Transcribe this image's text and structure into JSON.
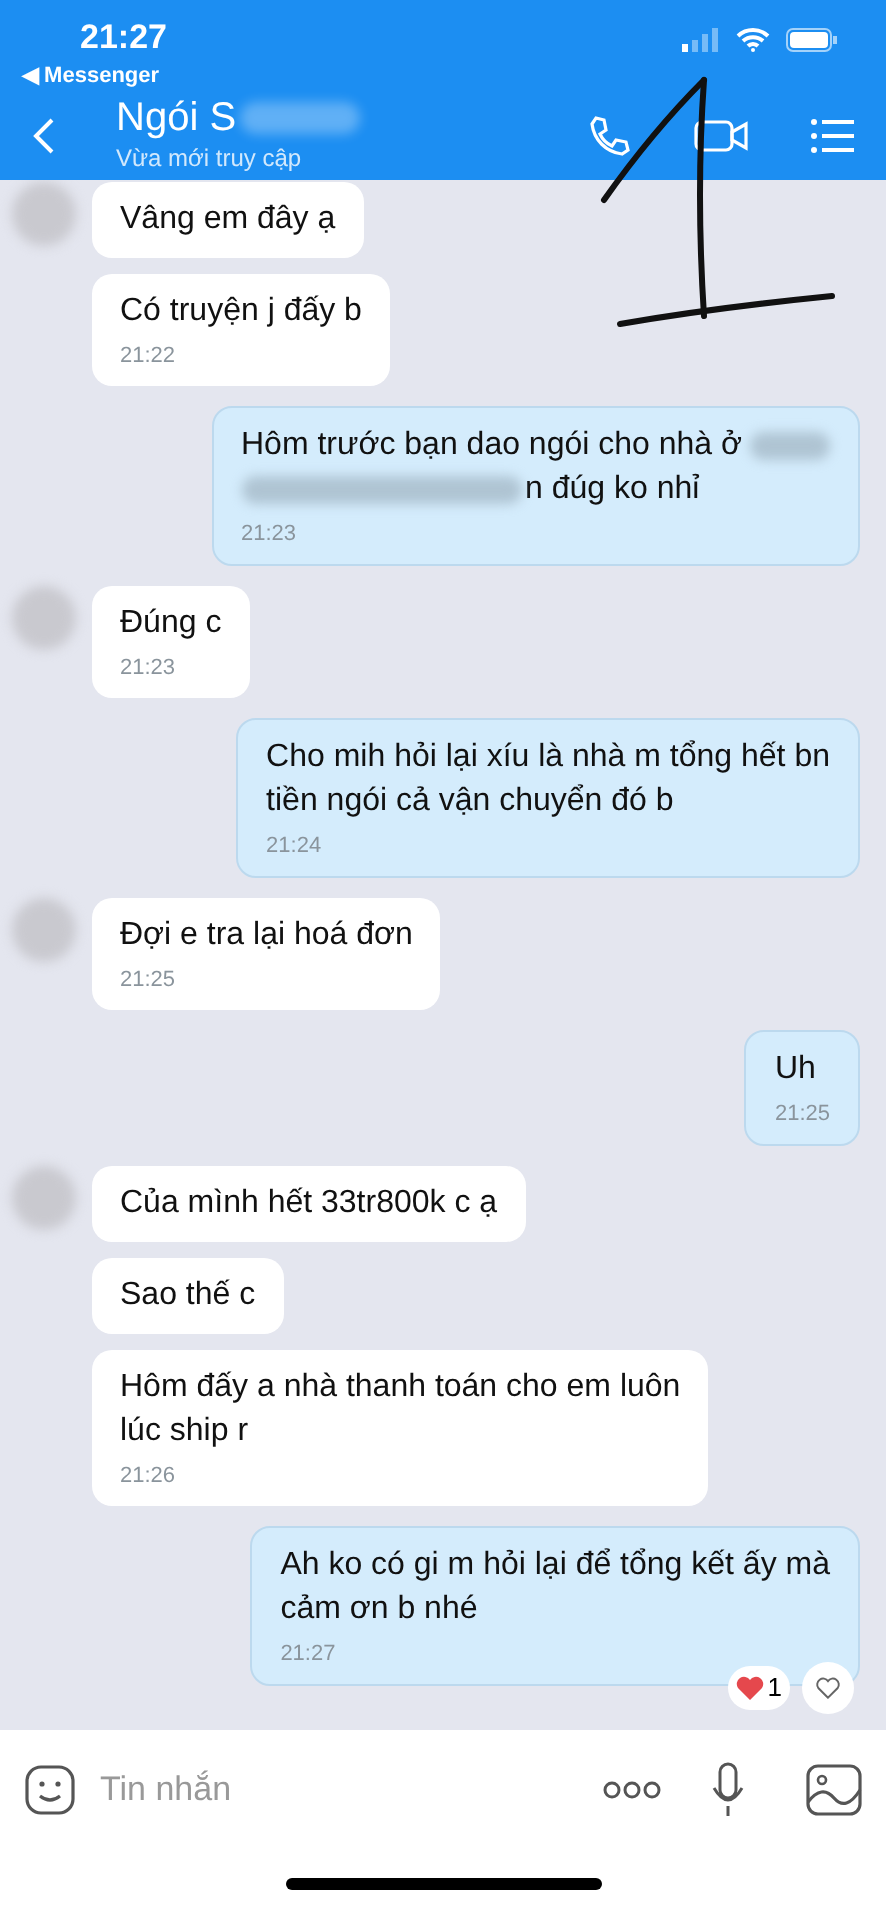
{
  "status_bar": {
    "time": "21:27",
    "back_app": "◀ Messenger"
  },
  "header": {
    "title": "Ngói S",
    "subtitle": "Vừa mới truy cập"
  },
  "messages": [
    {
      "kind": "incoming",
      "avatar": true,
      "lines": [
        "Vâng em đây ạ"
      ]
    },
    {
      "kind": "incoming",
      "avatar": false,
      "lines": [
        "Có truyện j đấy b"
      ],
      "time": "21:22"
    },
    {
      "kind": "outgoing",
      "lines": [
        "Hôm trước bạn dao ngói cho nhà ở",
        "n đúg ko nhỉ"
      ],
      "blurred": true,
      "time": "21:23"
    },
    {
      "kind": "incoming",
      "avatar": true,
      "lines": [
        "Đúng c"
      ],
      "time": "21:23"
    },
    {
      "kind": "outgoing",
      "lines": [
        "Cho mih hỏi lại xíu là nhà m tổng hết bn",
        "tiền ngói cả vận chuyển đó b"
      ],
      "time": "21:24"
    },
    {
      "kind": "incoming",
      "avatar": true,
      "lines": [
        "Đợi e tra lại hoá đơn"
      ],
      "time": "21:25"
    },
    {
      "kind": "outgoing",
      "lines": [
        "Uh"
      ],
      "time": "21:25"
    },
    {
      "kind": "incoming",
      "avatar": true,
      "lines": [
        "Của mình hết 33tr800k c ạ"
      ]
    },
    {
      "kind": "incoming",
      "avatar": false,
      "lines": [
        "Sao thế c"
      ]
    },
    {
      "kind": "incoming",
      "avatar": false,
      "lines": [
        "Hôm đấy a nhà thanh toán cho em luôn",
        "lúc ship r"
      ],
      "time": "21:26"
    },
    {
      "kind": "outgoing",
      "lines": [
        "Ah ko có gi m hỏi lại để tổng kết ấy mà",
        "cảm ơn b nhé"
      ],
      "time": "21:27",
      "reaction_count": "1"
    }
  ],
  "composer": {
    "placeholder": "Tin nhắn"
  }
}
